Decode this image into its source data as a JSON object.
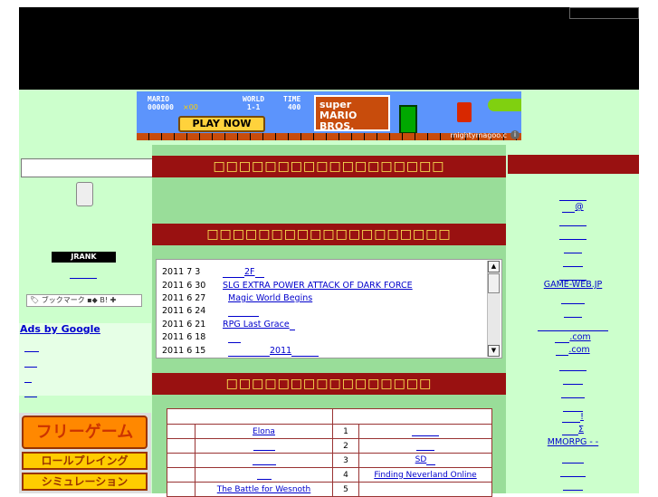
{
  "banner": {
    "hud_mario": "MARIO",
    "hud_score": "000000",
    "hud_coins": "×00",
    "hud_world": "WORLD",
    "hud_world_val": "1-1",
    "hud_time": "TIME",
    "hud_time_val": "400",
    "play_label": "PLAY NOW",
    "logo_text": "super MARIO BROS.",
    "url_text": "mightymagoo.c"
  },
  "left": {
    "search_placeholder": "",
    "jrank_label": "JRANK",
    "bookmark_label": "ブックマーク",
    "ads_title": "Ads by Google"
  },
  "menu": {
    "free_game": "フリーゲーム",
    "rpg": "ロールプレイング",
    "slg": "シミュレーション"
  },
  "center": {
    "section1_title": "□□□□□□□□□□□□□□□□□□",
    "section2_title": "□□□□□□□□□□□□□□□□□□□",
    "section3_title": "□□□□□□□□□□□□□□□□",
    "news": [
      {
        "date": "2011 7 3",
        "title": "2F"
      },
      {
        "date": "2011 6 30",
        "title": "SLG  EXTRA POWER ATTACK OF DARK FORCE"
      },
      {
        "date": "2011 6 27",
        "title": "Magic World Begins"
      },
      {
        "date": "2011 6 24",
        "title": ""
      },
      {
        "date": "2011 6 21",
        "title": "RPG  Last Grace"
      },
      {
        "date": "2011 6 18",
        "title": ""
      },
      {
        "date": "2011 6 15",
        "title": "2011"
      }
    ],
    "ranking": [
      {
        "left": "Elona",
        "rank": "1",
        "right": ""
      },
      {
        "left": "",
        "rank": "2",
        "right": ""
      },
      {
        "left": "",
        "rank": "3",
        "right": "SD"
      },
      {
        "left": "",
        "rank": "4",
        "right": "Finding Neverland Online"
      },
      {
        "left": "The Battle for Wesnoth",
        "rank": "5",
        "right": ""
      }
    ]
  },
  "right": {
    "links": [
      "",
      "@",
      "",
      "",
      "",
      "",
      "GAME-WEB.JP",
      "",
      "",
      "",
      ".com",
      ".com",
      "",
      "",
      "",
      "",
      "!",
      "Σ",
      "MMORPG  - -"
    ]
  }
}
